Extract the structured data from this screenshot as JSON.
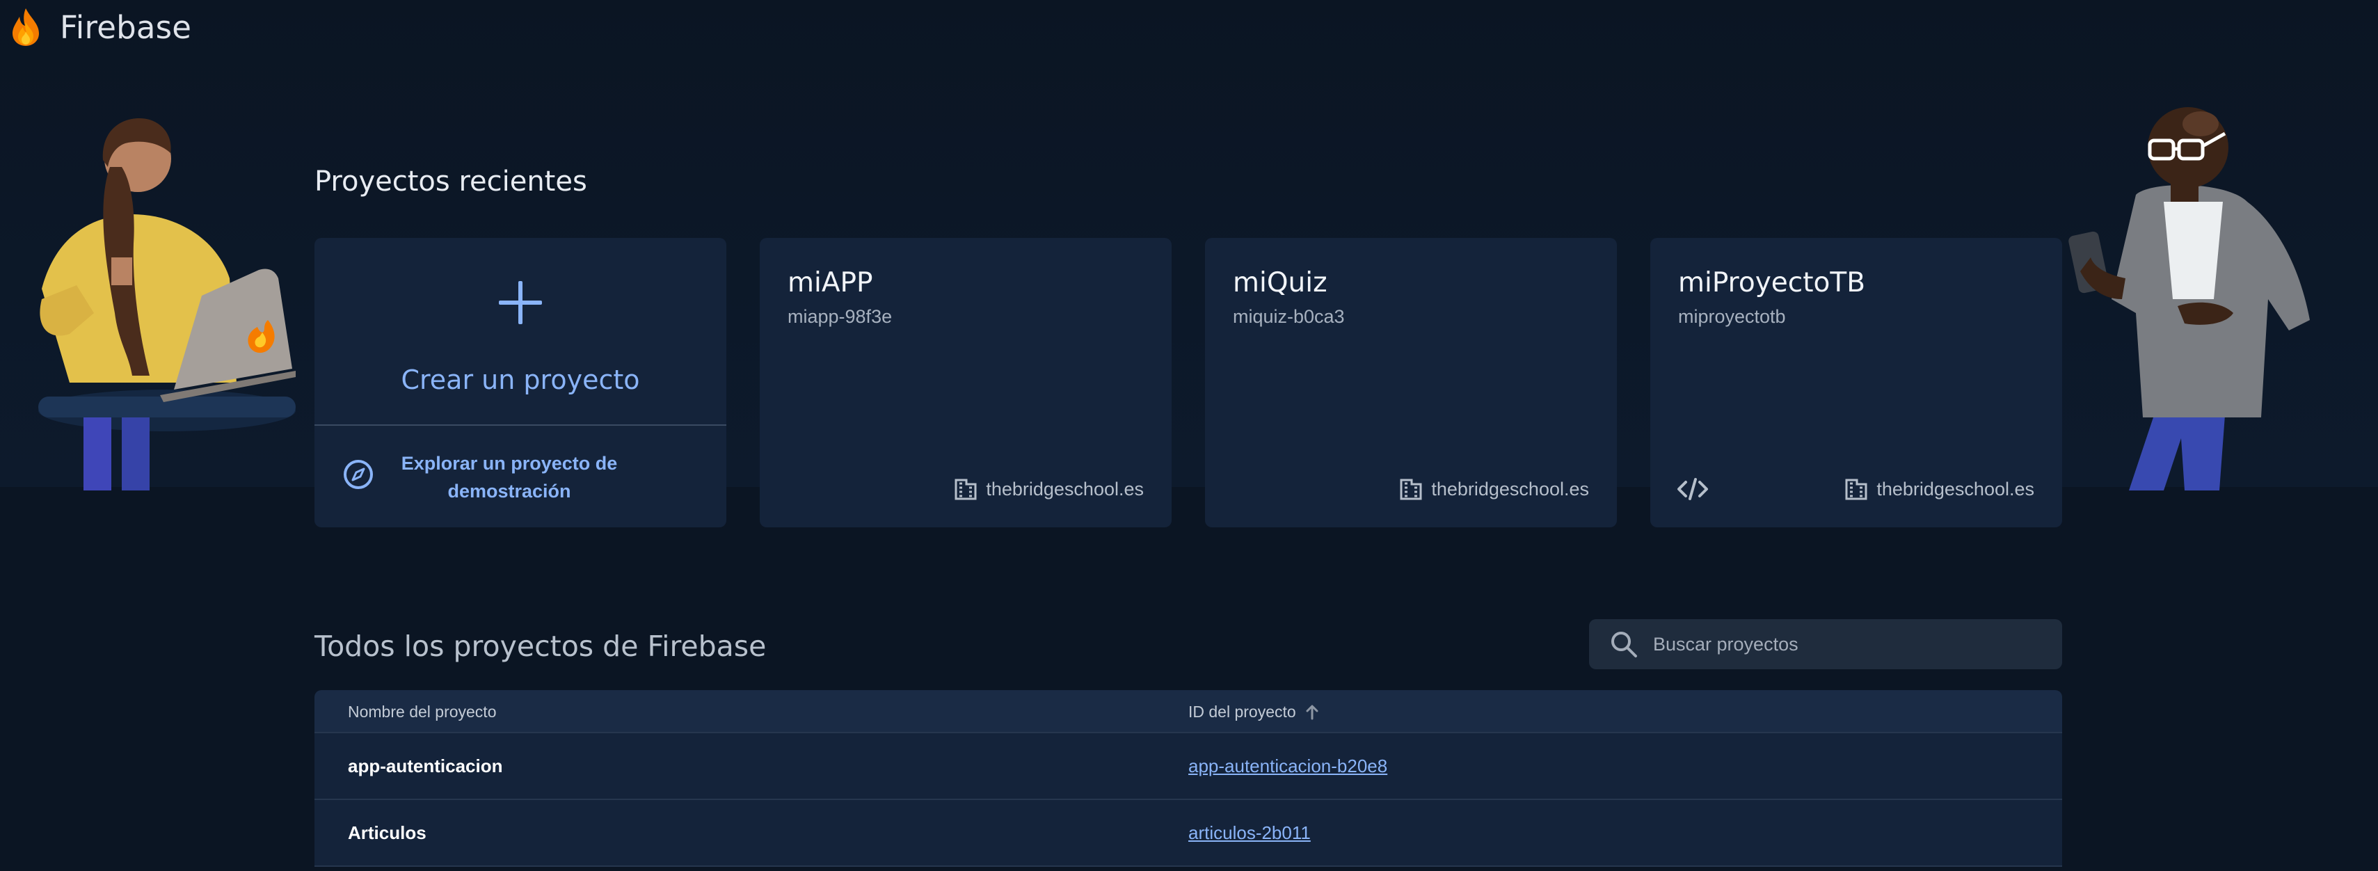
{
  "header": {
    "brand_name": "Firebase",
    "logo_icon": "firebase-flame-icon"
  },
  "recent": {
    "title": "Proyectos recientes",
    "create": {
      "label": "Crear un proyecto",
      "icon": "plus-icon"
    },
    "explore": {
      "label": "Explorar un proyecto de demostración",
      "icon": "compass-icon"
    },
    "projects": [
      {
        "name": "miAPP",
        "id": "miapp-98f3e",
        "org": "thebridgeschool.es",
        "org_icon": "building-icon"
      },
      {
        "name": "miQuiz",
        "id": "miquiz-b0ca3",
        "org": "thebridgeschool.es",
        "org_icon": "building-icon"
      },
      {
        "name": "miProyectoTB",
        "id": "miproyectotb",
        "org": "thebridgeschool.es",
        "org_icon": "building-icon",
        "extra_icon": "code-icon"
      }
    ]
  },
  "all_projects": {
    "title": "Todos los proyectos de Firebase",
    "search": {
      "placeholder": "Buscar proyectos",
      "icon": "search-icon"
    },
    "columns": [
      "Nombre del proyecto",
      "ID del proyecto"
    ],
    "sort_icon": "arrow-up-icon",
    "rows": [
      {
        "name": "app-autenticacion",
        "id": "app-autenticacion-b20e8"
      },
      {
        "name": "Articulos",
        "id": "articulos-2b011"
      }
    ]
  },
  "colors": {
    "background": "#0b1523",
    "card": "#14233a",
    "accent": "#8ab4f8",
    "table_header": "#1a2b45"
  }
}
